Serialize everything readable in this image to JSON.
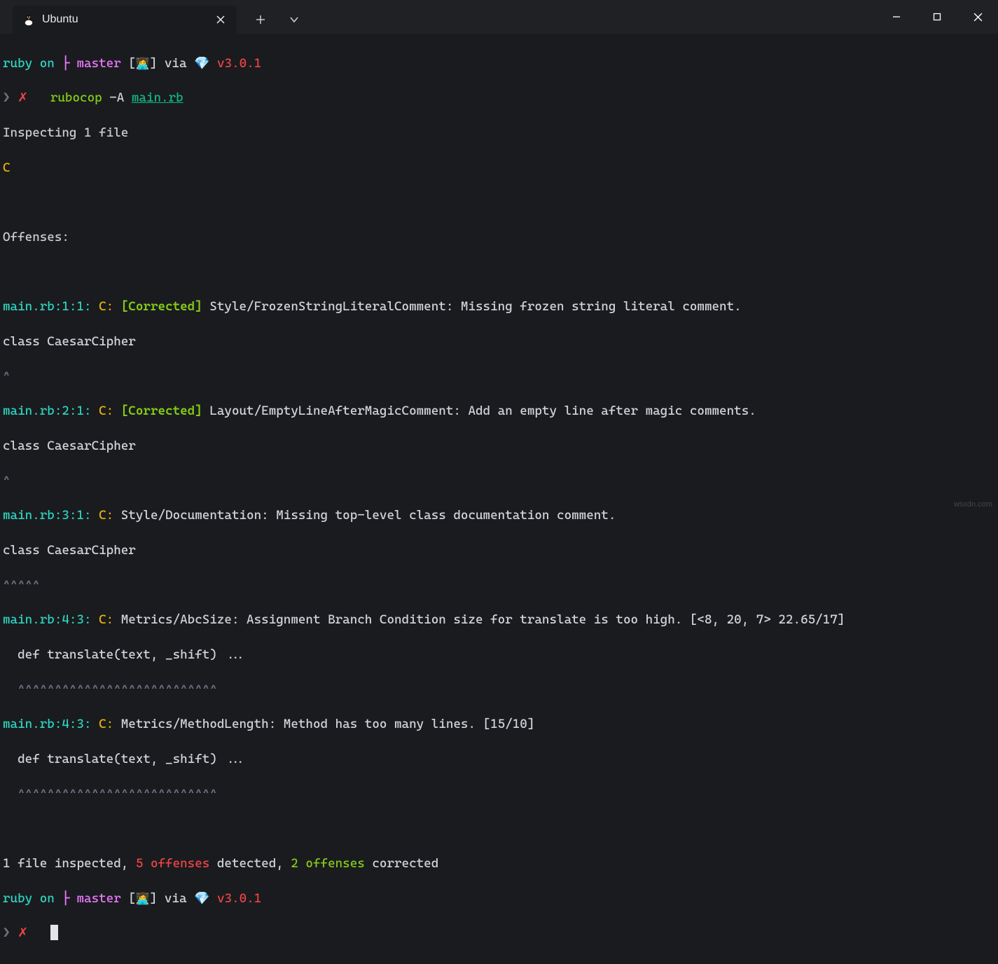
{
  "titlebar": {
    "tab_title": "Ubuntu"
  },
  "prompt": {
    "p1": "ruby on ",
    "branch_glyph": "├",
    "branch": " master ",
    "user_open": "[",
    "user_emoji": "👩‍💻",
    "user_close": "]",
    "via": " via ",
    "diamond": "💎",
    "version": " v3.0.1"
  },
  "cmd": {
    "arrow": "❯",
    "cross": "✗",
    "rubocop": "rubocop",
    "flag": " -A ",
    "file": "main.rb"
  },
  "out": {
    "inspecting": "Inspecting 1 file",
    "C": "C",
    "offenses_hdr": "Offenses:",
    "off1": {
      "loc": "main.rb:1:1:",
      "code": " C:",
      "tag": " [Corrected]",
      "msg": " Style/FrozenStringLiteralComment: Missing frozen string literal comment.",
      "src": "class CaesarCipher",
      "caret": "^"
    },
    "off2": {
      "loc": "main.rb:2:1:",
      "code": " C:",
      "tag": " [Corrected]",
      "msg": " Layout/EmptyLineAfterMagicComment: Add an empty line after magic comments.",
      "src": "class CaesarCipher",
      "caret": "^"
    },
    "off3": {
      "loc": "main.rb:3:1:",
      "code": " C:",
      "msg": " Style/Documentation: Missing top-level class documentation comment.",
      "src": "class CaesarCipher",
      "caret": "^^^^^"
    },
    "off4": {
      "loc": "main.rb:4:3:",
      "code": " C:",
      "msg": " Metrics/AbcSize: Assignment Branch Condition size for translate is too high. [<8, 20, 7> 22.65/17]",
      "src": "  def translate(text, _shift) ...",
      "caret": "  ^^^^^^^^^^^^^^^^^^^^^^^^^^^"
    },
    "off5": {
      "loc": "main.rb:4:3:",
      "code": " C:",
      "msg": " Metrics/MethodLength: Method has too many lines. [15/10]",
      "src": "  def translate(text, _shift) ...",
      "caret": "  ^^^^^^^^^^^^^^^^^^^^^^^^^^^"
    },
    "summary": {
      "p1": "1 file inspected, ",
      "det": "5 offenses",
      "p2": " detected, ",
      "cor": "2 offenses",
      "p3": " corrected"
    }
  },
  "watermark": "wsxdn.com"
}
